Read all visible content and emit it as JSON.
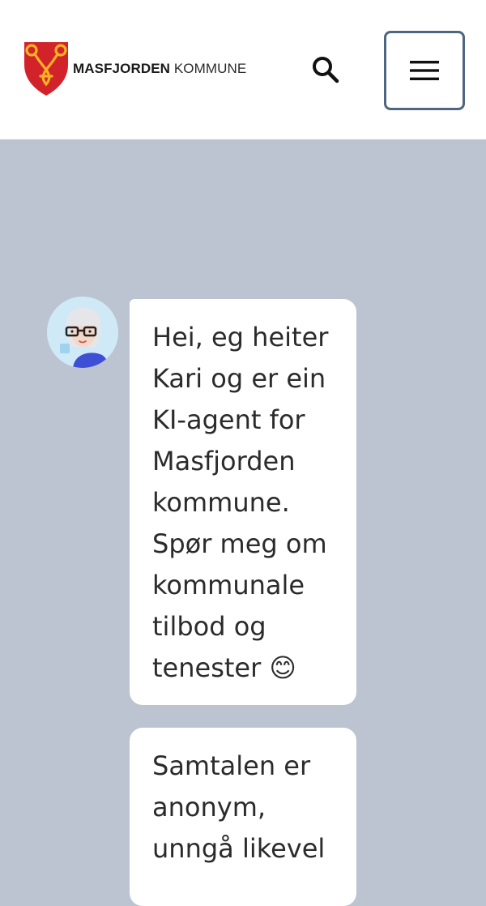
{
  "header": {
    "brand_bold": "MASFJORDEN",
    "brand_light": "KOMMUNE",
    "logo_icon": "masfjorden-crest-icon",
    "search_icon": "search-icon",
    "menu_icon": "hamburger-menu-icon"
  },
  "chat": {
    "agent_avatar": "kari-avatar",
    "messages": [
      {
        "text": "Hei, eg heiter Kari og er ein KI-agent for Masfjorden kommune. Spør meg om kommunale tilbod og tenester 😊"
      },
      {
        "text": "Samtalen er anonym, unngå likevel"
      }
    ]
  },
  "colors": {
    "background": "#bcc4d2",
    "header": "#ffffff",
    "menu_border": "#4f6682",
    "crest_red": "#d2232a",
    "crest_gold": "#f6b221"
  }
}
